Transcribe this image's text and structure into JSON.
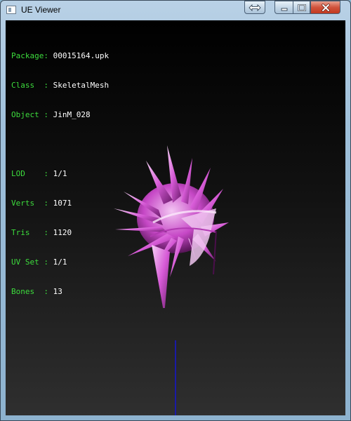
{
  "window": {
    "title": "UE Viewer"
  },
  "titlebar": {
    "buttons": [
      {
        "name": "swap-icon"
      },
      {
        "name": "minimize-icon"
      },
      {
        "name": "maximize-icon"
      },
      {
        "name": "close-icon"
      }
    ]
  },
  "info": {
    "package_label": "Package:",
    "package_value": "00015164.upk",
    "class_label": "Class  :",
    "class_value": "SkeletalMesh",
    "object_label": "Object :",
    "object_value": "JinM_028",
    "lod_label": "LOD    :",
    "lod_value": "1/1",
    "verts_label": "Verts  :",
    "verts_value": "1071",
    "tris_label": "Tris   :",
    "tris_value": "1120",
    "uvset_label": "UV Set :",
    "uvset_value": "1/1",
    "bones_label": "Bones  :",
    "bones_value": "13"
  },
  "colors": {
    "label": "#3ddc3d",
    "value": "#ffffff",
    "mesh": "#d65ad6",
    "axis": "#1a1aa6"
  }
}
